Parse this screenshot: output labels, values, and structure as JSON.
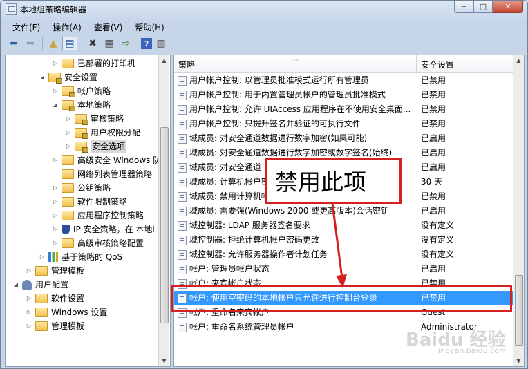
{
  "window": {
    "title": "本地组策略编辑器",
    "buttons": {
      "minimize": "─",
      "maximize": "□",
      "close": "✕"
    }
  },
  "menu": [
    "文件(F)",
    "操作(A)",
    "查看(V)",
    "帮助(H)"
  ],
  "toolbar_icons": [
    "back-arrow-icon",
    "forward-arrow-icon",
    "up-folder-icon",
    "show-tree-icon",
    "delete-icon",
    "properties-icon",
    "export-list-icon",
    "help-icon",
    "show-pane-icon"
  ],
  "tree": [
    {
      "label": "已部署的打印机",
      "depth": 3,
      "expand": "▷",
      "icon": "folder"
    },
    {
      "label": "安全设置",
      "depth": 2,
      "expand": "◢",
      "icon": "lock-folder"
    },
    {
      "label": "帐户策略",
      "depth": 3,
      "expand": "▷",
      "icon": "lock-folder"
    },
    {
      "label": "本地策略",
      "depth": 3,
      "expand": "◢",
      "icon": "lock-folder"
    },
    {
      "label": "审核策略",
      "depth": 4,
      "expand": "▷",
      "icon": "lock-folder"
    },
    {
      "label": "用户权限分配",
      "depth": 4,
      "expand": "▷",
      "icon": "lock-folder"
    },
    {
      "label": "安全选项",
      "depth": 4,
      "expand": "▷",
      "icon": "lock-folder",
      "selected": true
    },
    {
      "label": "高级安全 Windows 防",
      "depth": 3,
      "expand": "▷",
      "icon": "folder"
    },
    {
      "label": "网络列表管理器策略",
      "depth": 3,
      "expand": "",
      "icon": "folder"
    },
    {
      "label": "公钥策略",
      "depth": 3,
      "expand": "▷",
      "icon": "folder"
    },
    {
      "label": "软件限制策略",
      "depth": 3,
      "expand": "▷",
      "icon": "folder"
    },
    {
      "label": "应用程序控制策略",
      "depth": 3,
      "expand": "▷",
      "icon": "folder"
    },
    {
      "label": "IP 安全策略，在 本地i",
      "depth": 3,
      "expand": "▷",
      "icon": "shield"
    },
    {
      "label": "高级审核策略配置",
      "depth": 3,
      "expand": "▷",
      "icon": "folder"
    },
    {
      "label": "基于策略的 QoS",
      "depth": 2,
      "expand": "▷",
      "icon": "chart"
    },
    {
      "label": "管理模板",
      "depth": 1,
      "expand": "▷",
      "icon": "folder"
    },
    {
      "label": "用户配置",
      "depth": 0,
      "expand": "◢",
      "icon": "user"
    },
    {
      "label": "软件设置",
      "depth": 1,
      "expand": "▷",
      "icon": "folder"
    },
    {
      "label": "Windows 设置",
      "depth": 1,
      "expand": "▷",
      "icon": "folder"
    },
    {
      "label": "管理模板",
      "depth": 1,
      "expand": "▷",
      "icon": "folder"
    }
  ],
  "list": {
    "headers": {
      "policy": "策略",
      "setting": "安全设置"
    },
    "rows": [
      {
        "name": "用户帐户控制: 以管理员批准模式运行所有管理员",
        "value": "已禁用"
      },
      {
        "name": "用户帐户控制: 用于内置管理员帐户的管理员批准模式",
        "value": "已禁用"
      },
      {
        "name": "用户帐户控制: 允许 UIAccess 应用程序在不使用安全桌面...",
        "value": "已禁用"
      },
      {
        "name": "用户帐户控制: 只提升签名并验证的可执行文件",
        "value": "已禁用"
      },
      {
        "name": "域成员: 对安全通道数据进行数字加密(如果可能)",
        "value": "已启用"
      },
      {
        "name": "域成员: 对安全通道数据进行数字加密或数字签名(始终)",
        "value": "已启用"
      },
      {
        "name": "域成员: 对安全通道",
        "value": "已启用"
      },
      {
        "name": "域成员: 计算机帐户密",
        "value": "30 天"
      },
      {
        "name": "域成员: 禁用计算机帐",
        "value": "已禁用"
      },
      {
        "name": "域成员: 需要强(Windows 2000 或更高版本)会话密钥",
        "value": "已启用"
      },
      {
        "name": "域控制器: LDAP 服务器签名要求",
        "value": "没有定义"
      },
      {
        "name": "域控制器: 拒绝计算机帐户密码更改",
        "value": "没有定义"
      },
      {
        "name": "域控制器: 允许服务器操作者计划任务",
        "value": "没有定义"
      },
      {
        "name": "帐户: 管理员帐户状态",
        "value": "已启用"
      },
      {
        "name": "帐户: 来宾帐户状态",
        "value": "已禁用"
      },
      {
        "name": "帐户: 使用空密码的本地帐户只允许进行控制台登录",
        "value": "已禁用",
        "highlight": true
      },
      {
        "name": "帐户: 重命名来宾帐户",
        "value": "Guest"
      },
      {
        "name": "帐户: 重命名系统管理员帐户",
        "value": "Administrator"
      }
    ]
  },
  "annotation": {
    "text": "禁用此项"
  },
  "watermark": {
    "text": "Baidu 经验",
    "sub": "jingyan.baidu.com"
  }
}
